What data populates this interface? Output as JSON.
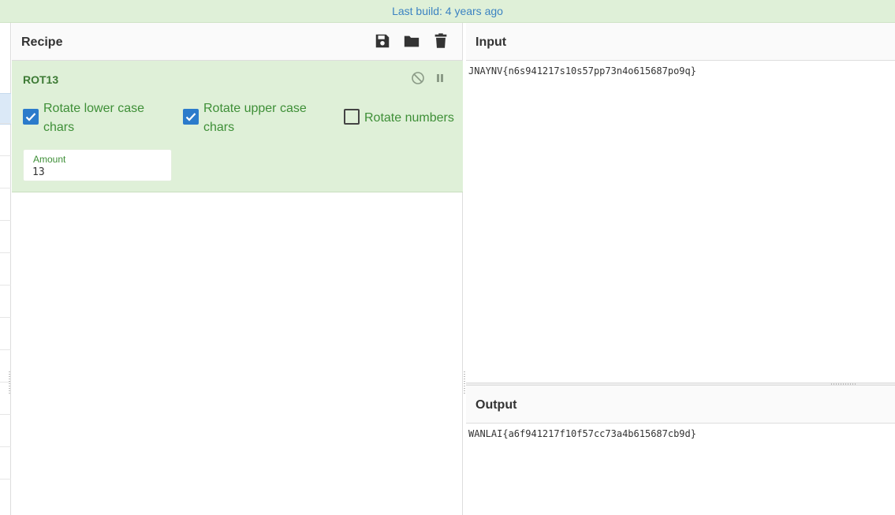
{
  "banner": {
    "text": "Last build: 4 years ago"
  },
  "recipe": {
    "title": "Recipe",
    "buttons": {
      "save": "save-icon",
      "load": "folder-icon",
      "clear": "trash-icon"
    },
    "operation": {
      "name": "ROT13",
      "controls": {
        "disable": "disable-icon",
        "pause": "pause-icon"
      },
      "options": [
        {
          "label": "Rotate lower case chars",
          "checked": true
        },
        {
          "label": "Rotate upper case chars",
          "checked": true
        },
        {
          "label": "Rotate numbers",
          "checked": false
        }
      ],
      "amount": {
        "label": "Amount",
        "value": "13"
      }
    }
  },
  "input": {
    "title": "Input",
    "text": "JNAYNV{n6s941217s10s57pp73n4o615687po9q}"
  },
  "output": {
    "title": "Output",
    "text": "WANLAI{a6f941217f10f57cc73a4b615687cb9d}"
  },
  "colors": {
    "banner_bg": "#dff0d8",
    "banner_text": "#3c83c2",
    "operation_bg": "#dff0d8",
    "operation_text": "#3e8f37",
    "checkbox_on": "#2b7bcb"
  }
}
